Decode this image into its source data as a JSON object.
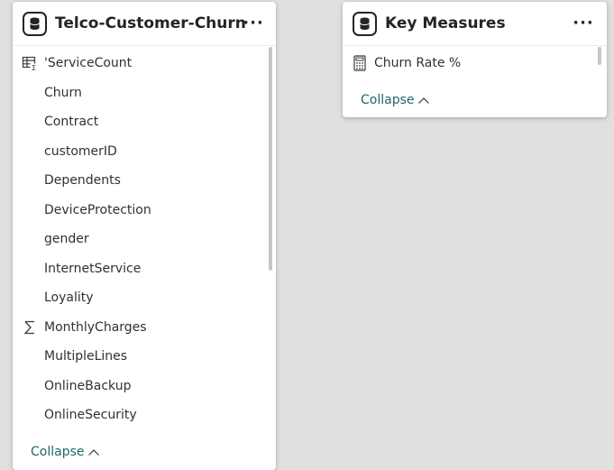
{
  "churn_table": {
    "title": "Telco-Customer-Churn",
    "more_label": "···",
    "icon": "database-icon",
    "fields": [
      {
        "label": "'ServiceCount",
        "icon": "calculated-column-icon"
      },
      {
        "label": "Churn",
        "icon": ""
      },
      {
        "label": "Contract",
        "icon": ""
      },
      {
        "label": "customerID",
        "icon": ""
      },
      {
        "label": "Dependents",
        "icon": ""
      },
      {
        "label": "DeviceProtection",
        "icon": ""
      },
      {
        "label": "gender",
        "icon": ""
      },
      {
        "label": "InternetService",
        "icon": ""
      },
      {
        "label": "Loyality",
        "icon": ""
      },
      {
        "label": "MonthlyCharges",
        "icon": "sigma-icon"
      },
      {
        "label": "MultipleLines",
        "icon": ""
      },
      {
        "label": "OnlineBackup",
        "icon": ""
      },
      {
        "label": "OnlineSecurity",
        "icon": ""
      }
    ],
    "collapse_label": "Collapse"
  },
  "measures_table": {
    "title": "Key Measures",
    "more_label": "···",
    "icon": "database-icon",
    "fields": [
      {
        "label": "Churn Rate %",
        "icon": "calculator-icon"
      }
    ],
    "collapse_label": "Collapse"
  },
  "colors": {
    "canvas": "#e1e0df",
    "card": "#ffffff",
    "link": "#1d6a62",
    "text": "#252423"
  }
}
